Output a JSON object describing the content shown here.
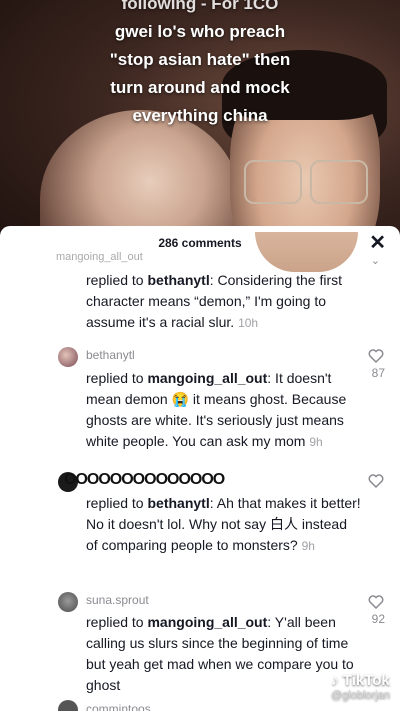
{
  "overlay_caption": [
    "following - For 1CO",
    "gwei lo's who preach",
    "\"stop asian hate\" then",
    "turn around and mock",
    "everything china"
  ],
  "comments_header": {
    "count_label": "286 comments",
    "close_icon": "close-icon"
  },
  "comments": {
    "top_truncated_username": "mangoing_all_out",
    "c1": {
      "reply_prefix": "replied to",
      "mention": "bethanytl",
      "text": ": Considering the first character means “demon,” I'm going to assume it's a racial slur.",
      "time": "10h"
    },
    "c2": {
      "username": "bethanytl",
      "reply_prefix": "replied to",
      "mention": "mangoing_all_out",
      "text": ": It doesn't mean demon 😭 it means ghost. Because ghosts are white. It's seriously just means white people. You can ask my mom",
      "time": "9h",
      "likes": "87"
    },
    "c3": {
      "username": "OOOOOOOOOOOOOO",
      "reply_prefix": "replied to",
      "mention": "bethanytl",
      "text": ": Ah that makes it better! No it doesn't lol. Why not say 白人 instead of comparing people to monsters?",
      "time": "9h"
    },
    "c4": {
      "username": "suna.sprout",
      "reply_prefix": "replied to",
      "mention": "mangoing_all_out",
      "text": ": Y'all been calling us slurs since the beginning of time but yeah get mad when we compare you to ghost",
      "likes": "92"
    },
    "bottom_truncated_username": "commintoos"
  },
  "watermark": {
    "brand": "TikTok",
    "handle": "@globlorjan"
  },
  "colors": {
    "text": "#161823",
    "muted": "#8a8b91",
    "sheet": "#ffffff"
  }
}
